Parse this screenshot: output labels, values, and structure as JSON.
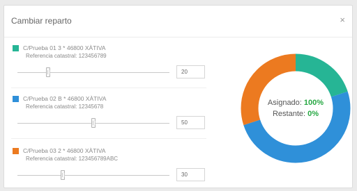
{
  "modal": {
    "title": "Cambiar reparto",
    "close_label": "×"
  },
  "items": [
    {
      "color": "#26b595",
      "address": "C/Prueba 01 3 * 46800 XÀTIVA",
      "reference": "Referencia catastral: 123456789",
      "value": "20",
      "slider_fraction": 0.2
    },
    {
      "color": "#2f90d9",
      "address": "C/Prueba 02 B * 46800 XÀTIVA",
      "reference": "Referencia catastral: 12345678",
      "value": "50",
      "slider_fraction": 0.5
    },
    {
      "color": "#ec7a20",
      "address": "C/Prueba 03 2 * 46800 XÀTIVA",
      "reference": "Referencia catastral: 123456789ABC",
      "value": "30",
      "slider_fraction": 0.3
    }
  ],
  "summary": {
    "assigned_label": "Asignado:",
    "assigned_value": "100%",
    "remaining_label": "Restante:",
    "remaining_value": "0%"
  },
  "chart_data": {
    "type": "pie",
    "categories": [
      "C/Prueba 01 3",
      "C/Prueba 02 B",
      "C/Prueba 03 2"
    ],
    "values": [
      20,
      50,
      30
    ],
    "colors": [
      "#26b595",
      "#2f90d9",
      "#ec7a20"
    ]
  }
}
